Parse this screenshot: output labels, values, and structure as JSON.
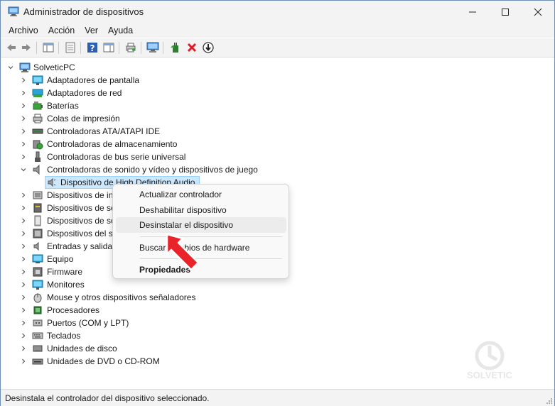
{
  "window": {
    "title": "Administrador de dispositivos"
  },
  "menubar": {
    "items": [
      "Archivo",
      "Acción",
      "Ver",
      "Ayuda"
    ]
  },
  "tree": {
    "root": "SolveticPC",
    "categories": [
      "Adaptadores de pantalla",
      "Adaptadores de red",
      "Baterías",
      "Colas de impresión",
      "Controladoras ATA/ATAPI IDE",
      "Controladoras de almacenamiento",
      "Controladoras de bus serie universal",
      "Controladoras de sonido y vídeo y dispositivos de juego",
      "Dispositivos de in",
      "Dispositivos de se",
      "Dispositivos de so",
      "Dispositivos del si",
      "Entradas y salidas",
      "Equipo",
      "Firmware",
      "Monitores",
      "Mouse y otros dispositivos señaladores",
      "Procesadores",
      "Puertos (COM y LPT)",
      "Teclados",
      "Unidades de disco",
      "Unidades de DVD o CD-ROM"
    ],
    "selected_child": "Dispositivo de High Definition Audio"
  },
  "context_menu": {
    "items": [
      "Actualizar controlador",
      "Deshabilitar dispositivo",
      "Desinstalar el dispositivo",
      "Buscar cambios de hardware",
      "Propiedades"
    ]
  },
  "statusbar": {
    "text": "Desinstala el controlador del dispositivo seleccionado."
  },
  "colors": {
    "accent": "#cce8ff",
    "titlebar": "#f3f3f3",
    "cursor": "#e8232a"
  }
}
